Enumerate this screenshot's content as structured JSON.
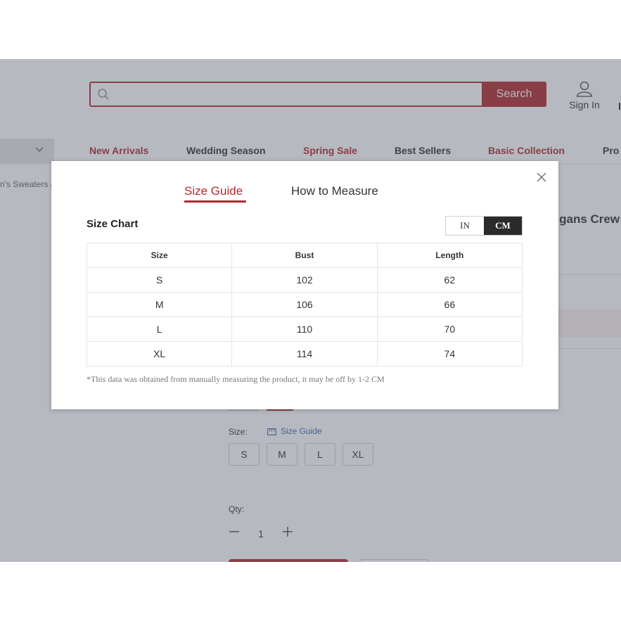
{
  "search": {
    "placeholder": "",
    "button_label": "Search"
  },
  "header": {
    "sign_in_label": "Sign In"
  },
  "nav": {
    "items": [
      {
        "label": "New Arrivals",
        "color": "#b22a30"
      },
      {
        "label": "Wedding Season",
        "color": "#333333"
      },
      {
        "label": "Spring Sale",
        "color": "#b22a30"
      },
      {
        "label": "Best Sellers",
        "color": "#333333"
      },
      {
        "label": "Basic Collection",
        "color": "#b22a30"
      },
      {
        "label": "Pro",
        "color": "#333333"
      }
    ]
  },
  "breadcrumb": {
    "text": "n's Sweaters a"
  },
  "product": {
    "title_partial": "digans Crew",
    "size_label": "Size:",
    "size_guide_link": "Size Guide",
    "size_options": [
      "S",
      "M",
      "L",
      "XL"
    ],
    "qty_label": "Qty:",
    "qty_value": "1"
  },
  "modal": {
    "tabs": {
      "size_guide": "Size Guide",
      "how_to_measure": "How to Measure"
    },
    "active_tab": "Size Guide",
    "chart_title": "Size Chart",
    "units": {
      "inch": "IN",
      "cm": "CM",
      "active": "CM"
    },
    "table": {
      "headers": [
        "Size",
        "Bust",
        "Length"
      ],
      "rows": [
        [
          "S",
          "102",
          "62"
        ],
        [
          "M",
          "106",
          "66"
        ],
        [
          "L",
          "110",
          "70"
        ],
        [
          "XL",
          "114",
          "74"
        ]
      ]
    },
    "note": "*This data was obtained from manually measuring the product, it may be off by 1-2 CM"
  },
  "colors": {
    "accent": "#b22a30",
    "link": "#3a66b0",
    "active_unit_bg": "#2b2b2b"
  }
}
